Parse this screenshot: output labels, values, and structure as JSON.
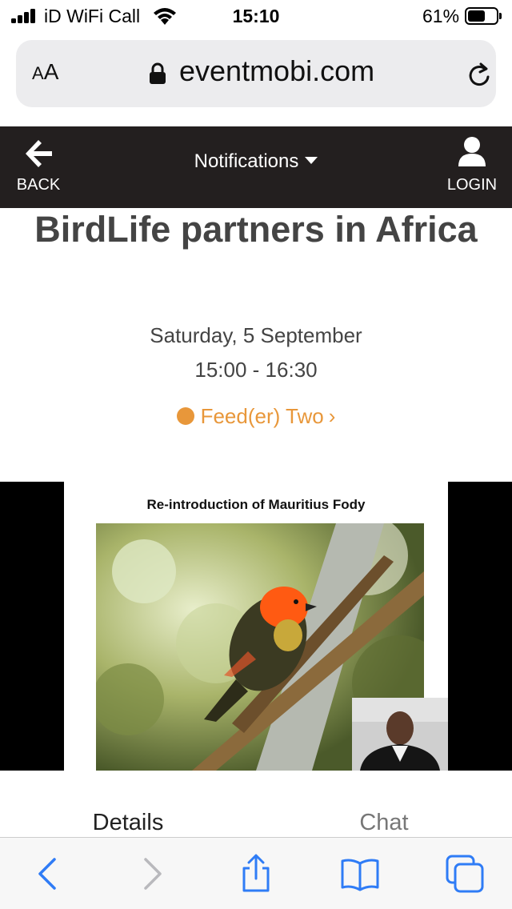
{
  "status_bar": {
    "carrier": "iD WiFi Call",
    "time": "15:10",
    "battery_percent_text": "61%",
    "battery_level": 0.61,
    "icons": [
      "signal-icon",
      "wifi-icon",
      "battery-icon"
    ]
  },
  "address_bar": {
    "text_size_label_big": "A",
    "text_size_label_small": "A",
    "url": "eventmobi.com",
    "icons": [
      "lock-icon",
      "reload-icon"
    ]
  },
  "app_nav": {
    "back_label": "BACK",
    "title": "Notifications",
    "login_label": "LOGIN",
    "icons": [
      "back-arrow-icon",
      "caret-down-icon",
      "user-icon"
    ]
  },
  "session": {
    "title": "BirdLife partners in Africa",
    "date": "Saturday, 5 September",
    "time": "15:00 - 16:30",
    "track": "Feed(er) Two",
    "track_color": "#e8973a"
  },
  "video": {
    "slide_title": "Re-introduction of Mauritius Fody"
  },
  "tabs": {
    "details": "Details",
    "chat": "Chat"
  },
  "toolbar": {
    "icons": [
      "back-chevron-icon",
      "forward-chevron-icon",
      "share-icon",
      "bookmarks-icon",
      "tabs-icon"
    ],
    "accent": "#2f7cf6"
  }
}
